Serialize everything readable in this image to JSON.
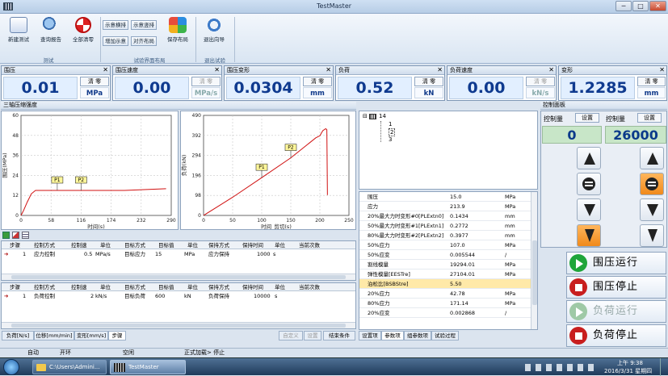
{
  "window": {
    "title": "TestMaster",
    "minimize": "─",
    "maximize": "□",
    "close": "✕"
  },
  "ribbon": {
    "buttons": [
      {
        "label": "新建测试",
        "icon": "new-test-icon"
      },
      {
        "label": "查询报告",
        "icon": "search-report-icon"
      },
      {
        "label": "全部清零",
        "icon": "lifebuoy-icon"
      }
    ],
    "group_test": "测试",
    "layout_buttons": [
      "示意横排",
      "示意竖排",
      "增加示意",
      "对齐布局"
    ],
    "save_layout": "保存布局",
    "group_layout": "试验界面布局",
    "exit_wizard": "退出向导",
    "group_exit": "退出试验"
  },
  "panels": [
    {
      "title": "围压",
      "value": "0.01",
      "clear": "清 零",
      "unit": "MPa",
      "enabled": true
    },
    {
      "title": "围压速度",
      "value": "0.00",
      "clear": "清 零",
      "unit": "MPa/s",
      "enabled": false
    },
    {
      "title": "围压变形",
      "value": "0.0304",
      "clear": "清 零",
      "unit": "mm",
      "enabled": true
    },
    {
      "title": "负荷",
      "value": "0.52",
      "clear": "清 零",
      "unit": "kN",
      "enabled": true
    },
    {
      "title": "负荷速度",
      "value": "0.00",
      "clear": "清 零",
      "unit": "kN/s",
      "enabled": false
    },
    {
      "title": "变形",
      "value": "1.2285",
      "clear": "清 零",
      "unit": "mm",
      "enabled": true
    }
  ],
  "chart_section": {
    "title": "三轴压缩强度"
  },
  "chart_data": [
    {
      "type": "line",
      "xlabel": "时间(s)",
      "ylabel": "围压(MPa)",
      "xlim": [
        0,
        290
      ],
      "ylim": [
        0,
        60
      ],
      "xticks": [
        "0",
        "58",
        "116",
        "174",
        "232",
        "290"
      ],
      "yticks": [
        "0",
        "12",
        "24",
        "36",
        "48",
        "60"
      ],
      "series": [
        {
          "x": [
            0,
            5,
            12,
            20,
            28,
            40,
            100,
            200,
            280
          ],
          "y": [
            0,
            3,
            8,
            13,
            15,
            15,
            15,
            15,
            16
          ]
        }
      ],
      "markers": [
        {
          "label": "P1",
          "x": 70,
          "y": 15
        },
        {
          "label": "P2",
          "x": 116,
          "y": 15
        }
      ]
    },
    {
      "type": "line",
      "xlabel": "时间_剪切(s)",
      "ylabel": "负荷(kN)",
      "xlim": [
        0,
        250
      ],
      "ylim": [
        0,
        490
      ],
      "xticks": [
        "0",
        "50",
        "100",
        "150",
        "200",
        "250"
      ],
      "yticks": [
        "0",
        "98",
        "196",
        "294",
        "392",
        "490"
      ],
      "series": [
        {
          "x": [
            0,
            50,
            100,
            150,
            193,
            200,
            205,
            210,
            212,
            213
          ],
          "y": [
            0,
            89,
            185,
            282,
            380,
            390,
            415,
            425,
            420,
            100
          ]
        }
      ],
      "markers": [
        {
          "label": "P1",
          "x": 100,
          "y": 185
        },
        {
          "label": "P2",
          "x": 150,
          "y": 282
        }
      ]
    }
  ],
  "step_table_headers": [
    "步骤",
    "控制方式",
    "控制速",
    "单位",
    "目标方式",
    "目标值",
    "单位",
    "保持方式",
    "保持时间",
    "单位",
    "当前次数"
  ],
  "step_table_1": {
    "num": "1",
    "control": "应力控制",
    "speed": "0.5",
    "unit": "MPa/s",
    "target_mode": "目标应力",
    "target": "15",
    "target_unit": "MPa",
    "hold": "应力保持",
    "hold_time": "1000",
    "hold_unit": "s",
    "count": ""
  },
  "step_table_2": {
    "num": "1",
    "control": "负荷控制",
    "speed": "2",
    "unit": "kN/s",
    "target_mode": "目标负荷",
    "target": "600",
    "target_unit": "kN",
    "hold": "负荷保持",
    "hold_time": "10000",
    "hold_unit": "s",
    "count": ""
  },
  "bottom_tabs": [
    "负荷[N/s]",
    "位移[mm/min]",
    "变形[mm/s]",
    "步骤"
  ],
  "bottom_buttons": [
    "自定义",
    "设置",
    "结束条件"
  ],
  "tree": {
    "root": "14",
    "children": [
      "1",
      "2",
      "3"
    ]
  },
  "props": [
    {
      "name": "围压",
      "value": "15.0",
      "unit": "MPa"
    },
    {
      "name": "应力",
      "value": "213.9",
      "unit": "MPa"
    },
    {
      "name": "20%最大力时变形#0[PLExtn0]",
      "value": "0.1434",
      "unit": "mm"
    },
    {
      "name": "50%最大力时变形#1[PLExtn1]",
      "value": "0.2772",
      "unit": "mm"
    },
    {
      "name": "80%最大力时变形#2[PLExtn2]",
      "value": "0.3977",
      "unit": "mm"
    },
    {
      "name": "50%应力",
      "value": "107.0",
      "unit": "MPa"
    },
    {
      "name": "50%应变",
      "value": "0.005544",
      "unit": "/"
    },
    {
      "name": "割线模量",
      "value": "19294.01",
      "unit": "MPa"
    },
    {
      "name": "弹性模量[EESTre]",
      "value": "27104.01",
      "unit": "MPa"
    },
    {
      "name": "泊松比[BSBStre]",
      "value": "5.50",
      "unit": ""
    },
    {
      "name": "20%应力",
      "value": "42.78",
      "unit": "MPa"
    },
    {
      "name": "80%应力",
      "value": "171.14",
      "unit": "MPa"
    },
    {
      "name": "20%应变",
      "value": "0.002868",
      "unit": "/"
    }
  ],
  "right_tabs": [
    "设置项",
    "参数项",
    "组参数项",
    "试验过程"
  ],
  "control": {
    "title": "控制面板",
    "label1": "控制量",
    "set1": "设置",
    "label2": "控制量",
    "set2": "设置",
    "value1": "0",
    "value2": "26000"
  },
  "actions": [
    {
      "label": "围压运行",
      "color": "#1fa53a",
      "enabled": true
    },
    {
      "label": "围压停止",
      "color": "#c81e1e",
      "enabled": true
    },
    {
      "label": "负荷运行",
      "color": "#9fc9a6",
      "enabled": false
    },
    {
      "label": "负荷停止",
      "color": "#c81e1e",
      "enabled": true
    }
  ],
  "statusbar": {
    "s1": "自动",
    "s2": "开环",
    "s3": "空闲",
    "s4": "正式加载> 停止"
  },
  "taskbar": {
    "explorer": "C:\\Users\\Admini...",
    "app": "TestMaster",
    "time": "上午 9:38",
    "date": "2016/3/31 星期四"
  }
}
